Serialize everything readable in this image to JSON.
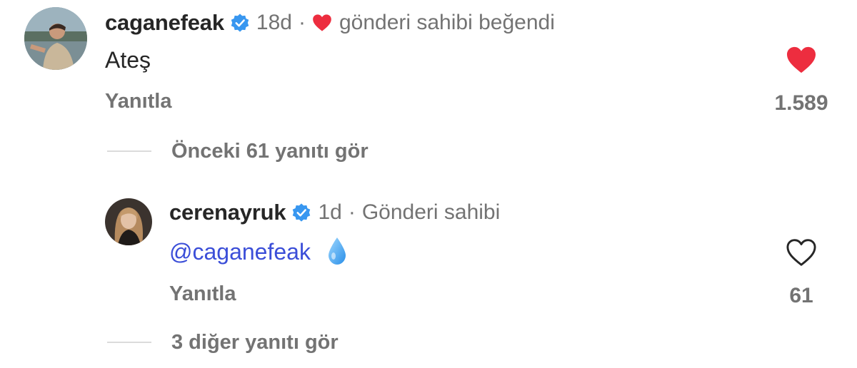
{
  "comment1": {
    "username": "caganefeak",
    "time": "18d",
    "separator": "·",
    "liked_by_author_text": "gönderi sahibi beğendi",
    "text": "Ateş",
    "reply_label": "Yanıtla",
    "like_count": "1.589",
    "liked": true,
    "view_replies": "Önceki 61 yanıtı gör"
  },
  "comment2": {
    "username": "cerenayruk",
    "time": "1d",
    "separator": "·",
    "author_label": "Gönderi sahibi",
    "mention": "@caganefeak",
    "emoji": "droplet",
    "reply_label": "Yanıtla",
    "like_count": "61",
    "liked": false,
    "view_replies": "3 diğer yanıtı gör"
  },
  "colors": {
    "verified": "#3897f0",
    "liked_heart": "#ed2d3f",
    "mention": "#3b4ed8",
    "secondary_text": "#737373"
  }
}
